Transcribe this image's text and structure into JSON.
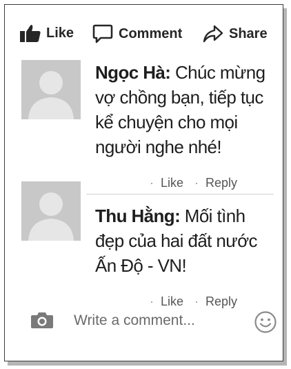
{
  "actions": {
    "like_label": "Like",
    "comment_label": "Comment",
    "share_label": "Share"
  },
  "comments": [
    {
      "author": "Ngọc Hà:",
      "text": "Chúc mừng vợ chồng bạn, tiếp tục kể chuyện cho mọi người nghe nhé!",
      "like_label": "Like",
      "reply_label": "Reply"
    },
    {
      "author": "Thu Hằng:",
      "text": "Mối tình đẹp của hai đất nước Ấn Độ - VN!",
      "like_label": "Like",
      "reply_label": "Reply"
    }
  ],
  "composer": {
    "placeholder": "Write a comment..."
  },
  "meta_separator": "·",
  "icons": {
    "like": "thumbs-up-icon",
    "comment": "speech-bubble-icon",
    "share": "share-arrow-icon",
    "camera": "camera-icon",
    "emoji": "smiley-icon"
  },
  "colors": {
    "text": "#1e1e1e",
    "muted": "#555555",
    "avatar_bg": "#c8c8c8",
    "avatar_fg": "#e6e6e6"
  }
}
